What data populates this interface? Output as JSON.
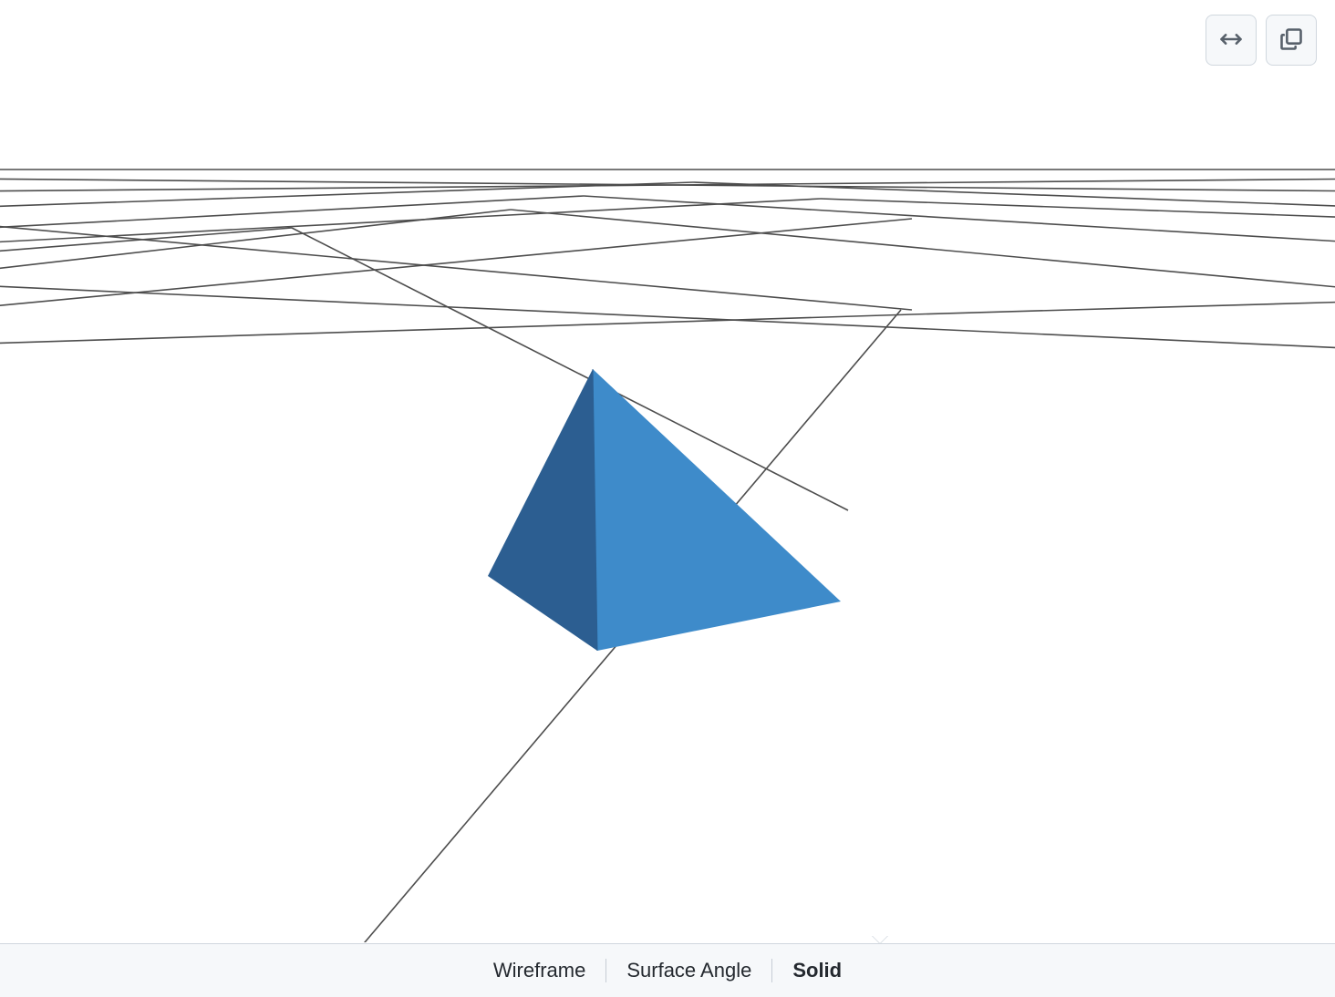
{
  "toolbar": {
    "expand_button": "Expand viewport",
    "popout_button": "Open in new window"
  },
  "modes": {
    "items": [
      {
        "label": "Wireframe",
        "active": false
      },
      {
        "label": "Surface Angle",
        "active": false
      },
      {
        "label": "Solid",
        "active": true
      }
    ]
  },
  "scene": {
    "object": "tetrahedron",
    "shading": "solid",
    "face_colors": {
      "left": "#2c5e91",
      "right": "#3e8bca"
    },
    "grid_color": "#4d4d4d",
    "background": "#ffffff"
  }
}
